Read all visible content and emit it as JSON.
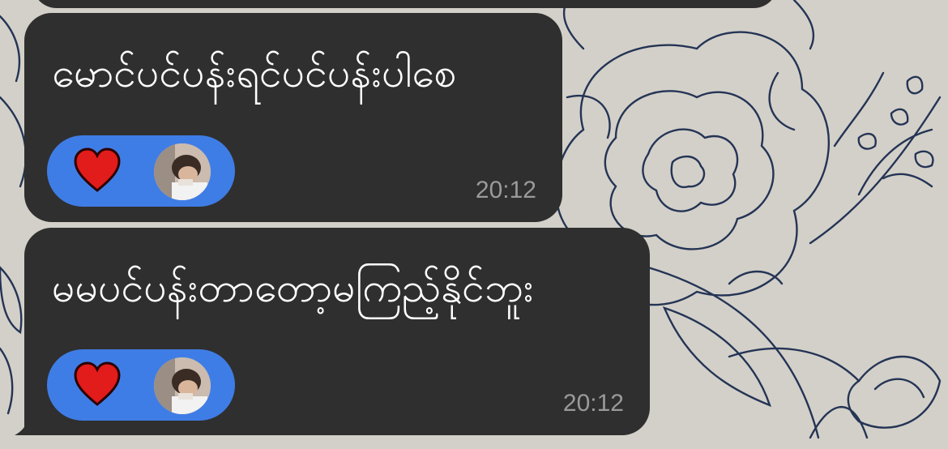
{
  "messages": [
    {
      "text": "မောင်ပင်ပန်းရင်ပင်ပန်းပါစေ",
      "reaction_icon": "heart-icon",
      "time": "20:12"
    },
    {
      "text": "မမပင်ပန်းတာတော့မကြည့်နိုင်ဘူး",
      "reaction_icon": "heart-icon",
      "time": "20:12"
    }
  ],
  "colors": {
    "bubble": "#2f2f2f",
    "reaction_pill": "#3f7de6",
    "heart": "#e21b1b",
    "wallpaper": "#d3d0c9"
  }
}
